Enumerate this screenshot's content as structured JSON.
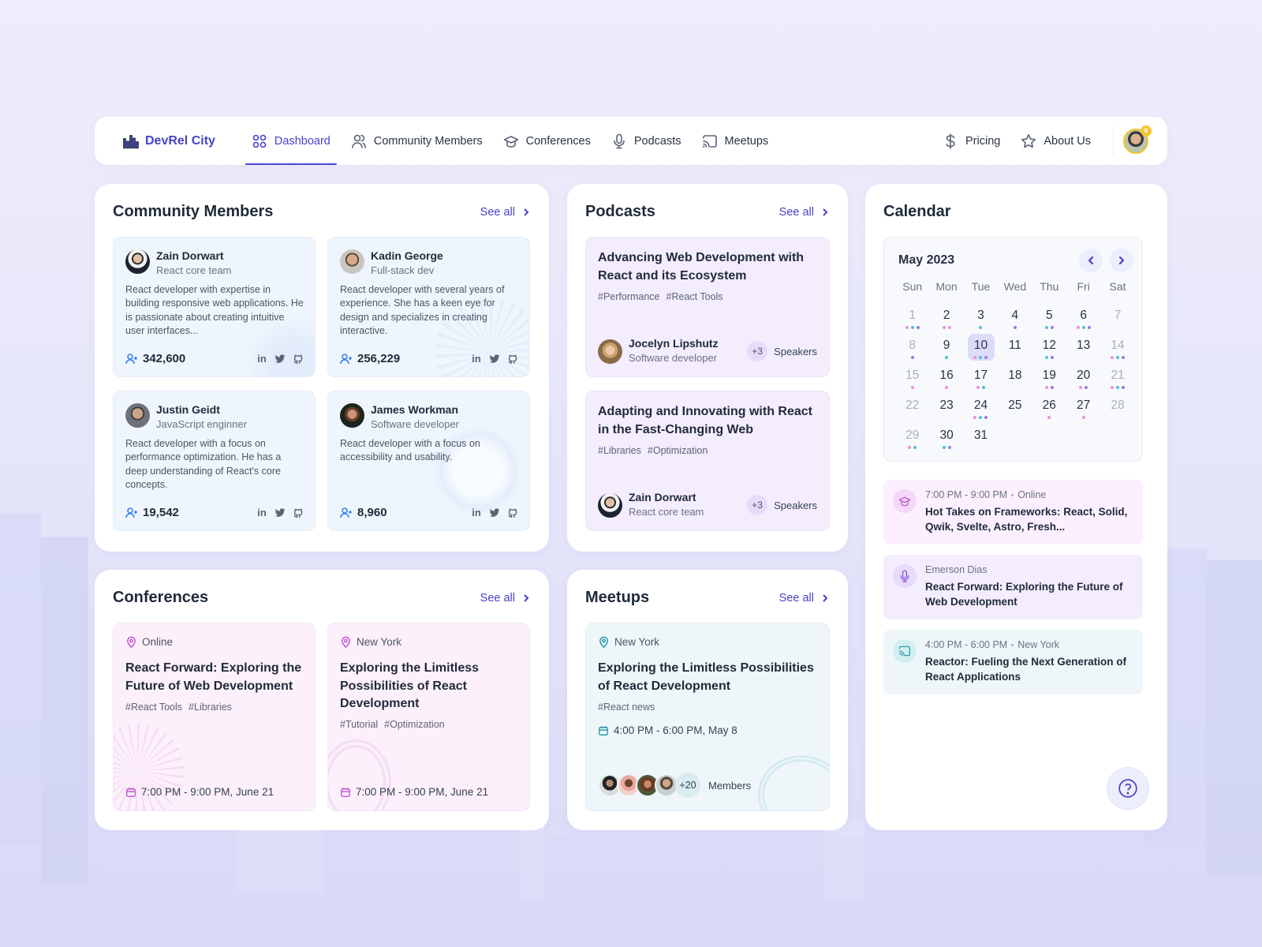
{
  "nav": {
    "brand": "DevRel City",
    "items": [
      {
        "label": "Dashboard",
        "icon": "grid-icon",
        "active": true
      },
      {
        "label": "Community Members",
        "icon": "users-icon",
        "active": false
      },
      {
        "label": "Conferences",
        "icon": "graduation-cap-icon",
        "active": false
      },
      {
        "label": "Podcasts",
        "icon": "microphone-icon",
        "active": false
      },
      {
        "label": "Meetups",
        "icon": "cast-icon",
        "active": false
      }
    ],
    "right_items": [
      {
        "label": "Pricing",
        "icon": "dollar-icon"
      },
      {
        "label": "About Us",
        "icon": "star-icon"
      }
    ],
    "avatar_badge": "♛"
  },
  "colors": {
    "accent": "#4743c9",
    "dot_pink": "#ee8fdc",
    "dot_teal": "#4ec3cf",
    "dot_purple": "#9a7be0"
  },
  "community": {
    "title": "Community Members",
    "see_all": "See all",
    "members": [
      {
        "name": "Zain Dorwart",
        "role": "React core team",
        "bio": "React developer with expertise in building responsive web applications. He is passionate about creating intuitive user interfaces...",
        "followers": "342,600"
      },
      {
        "name": "Kadin George",
        "role": "Full-stack dev",
        "bio": "React developer with several years of experience. She has a keen eye for design and specializes in creating interactive.",
        "followers": "256,229"
      },
      {
        "name": "Justin Geidt",
        "role": "JavaScript enginner",
        "bio": "React developer with a focus on performance optimization. He has a deep understanding of React's core concepts.",
        "followers": "19,542"
      },
      {
        "name": "James Workman",
        "role": "Software developer",
        "bio": "React developer with a focus on accessibility and usability.",
        "followers": "8,960"
      }
    ],
    "social_labels": {
      "linkedin": "in"
    }
  },
  "podcasts": {
    "title": "Podcasts",
    "see_all": "See all",
    "items": [
      {
        "title": "Advancing Web Development with React and its Ecosystem",
        "tags": [
          "#Performance",
          "#React Tools"
        ],
        "speaker": "Jocelyn Lipshutz",
        "speaker_role": "Software developer",
        "more": "+3",
        "more_label": "Speakers"
      },
      {
        "title": "Adapting and Innovating with React in the Fast-Changing Web",
        "tags": [
          "#Libraries",
          "#Optimization"
        ],
        "speaker": "Zain Dorwart",
        "speaker_role": "React core team",
        "more": "+3",
        "more_label": "Speakers"
      }
    ]
  },
  "conferences": {
    "title": "Conferences",
    "see_all": "See all",
    "items": [
      {
        "location": "Online",
        "title": "React Forward: Exploring the Future of Web Development",
        "tags": [
          "#React Tools",
          "#Libraries"
        ],
        "when": "7:00 PM - 9:00 PM, June 21"
      },
      {
        "location": "New York",
        "title": "Exploring the Limitless Possibilities of React Development",
        "tags": [
          "#Tutorial",
          "#Optimization"
        ],
        "when": "7:00 PM - 9:00 PM, June 21"
      }
    ]
  },
  "meetups": {
    "title": "Meetups",
    "see_all": "See all",
    "item": {
      "location": "New York",
      "title": "Exploring the Limitless Possibilities of React Development",
      "tags": [
        "#React news"
      ],
      "when": "4:00 PM - 6:00 PM, May 8",
      "more": "+20",
      "more_label": "Members"
    }
  },
  "calendar": {
    "title": "Calendar",
    "month": "May 2023",
    "weekdays": [
      "Sun",
      "Mon",
      "Tue",
      "Wed",
      "Thu",
      "Fri",
      "Sat"
    ],
    "selected_day": 10,
    "days": [
      {
        "d": 1,
        "muted": true,
        "dots": [
          "p",
          "t",
          "v"
        ]
      },
      {
        "d": 2,
        "dots": [
          "p",
          "p"
        ]
      },
      {
        "d": 3,
        "dots": [
          "t"
        ]
      },
      {
        "d": 4,
        "dots": [
          "v"
        ]
      },
      {
        "d": 5,
        "dots": [
          "t",
          "v"
        ]
      },
      {
        "d": 6,
        "dots": [
          "p",
          "t",
          "v"
        ]
      },
      {
        "d": 7,
        "muted": true,
        "dots": []
      },
      {
        "d": 8,
        "muted": true,
        "dots": [
          "v"
        ]
      },
      {
        "d": 9,
        "dots": [
          "t"
        ]
      },
      {
        "d": 10,
        "dots": [
          "p",
          "t",
          "v"
        ]
      },
      {
        "d": 11,
        "dots": []
      },
      {
        "d": 12,
        "dots": [
          "t",
          "v"
        ]
      },
      {
        "d": 13,
        "dots": []
      },
      {
        "d": 14,
        "muted": true,
        "dots": [
          "p",
          "t",
          "v"
        ]
      },
      {
        "d": 15,
        "muted": true,
        "dots": [
          "p"
        ]
      },
      {
        "d": 16,
        "dots": [
          "p"
        ]
      },
      {
        "d": 17,
        "dots": [
          "p",
          "t"
        ]
      },
      {
        "d": 18,
        "dots": []
      },
      {
        "d": 19,
        "dots": [
          "p",
          "v"
        ]
      },
      {
        "d": 20,
        "dots": [
          "p",
          "v"
        ]
      },
      {
        "d": 21,
        "muted": true,
        "dots": [
          "p",
          "t",
          "v"
        ]
      },
      {
        "d": 22,
        "muted": true,
        "dots": []
      },
      {
        "d": 23,
        "dots": []
      },
      {
        "d": 24,
        "dots": [
          "p",
          "t",
          "v"
        ]
      },
      {
        "d": 25,
        "dots": []
      },
      {
        "d": 26,
        "dots": [
          "p"
        ]
      },
      {
        "d": 27,
        "dots": [
          "p"
        ]
      },
      {
        "d": 28,
        "muted": true,
        "dots": []
      },
      {
        "d": 29,
        "muted": true,
        "dots": [
          "p",
          "t"
        ]
      },
      {
        "d": 30,
        "dots": [
          "t",
          "v"
        ]
      },
      {
        "d": 31,
        "dots": []
      }
    ],
    "agenda": [
      {
        "type": "conference",
        "meta_a": "7:00 PM - 9:00 PM",
        "meta_b": "Online",
        "title": "Hot Takes on Frameworks: React, Solid, Qwik, Svelte, Astro, Fresh..."
      },
      {
        "type": "podcast",
        "meta_a": "Emerson Dias",
        "meta_b": "",
        "title": "React Forward: Exploring the Future of Web Development"
      },
      {
        "type": "meetup",
        "meta_a": "4:00 PM - 6:00 PM",
        "meta_b": "New York",
        "title": "Reactor: Fueling the Next Generation of React Applications"
      }
    ]
  }
}
